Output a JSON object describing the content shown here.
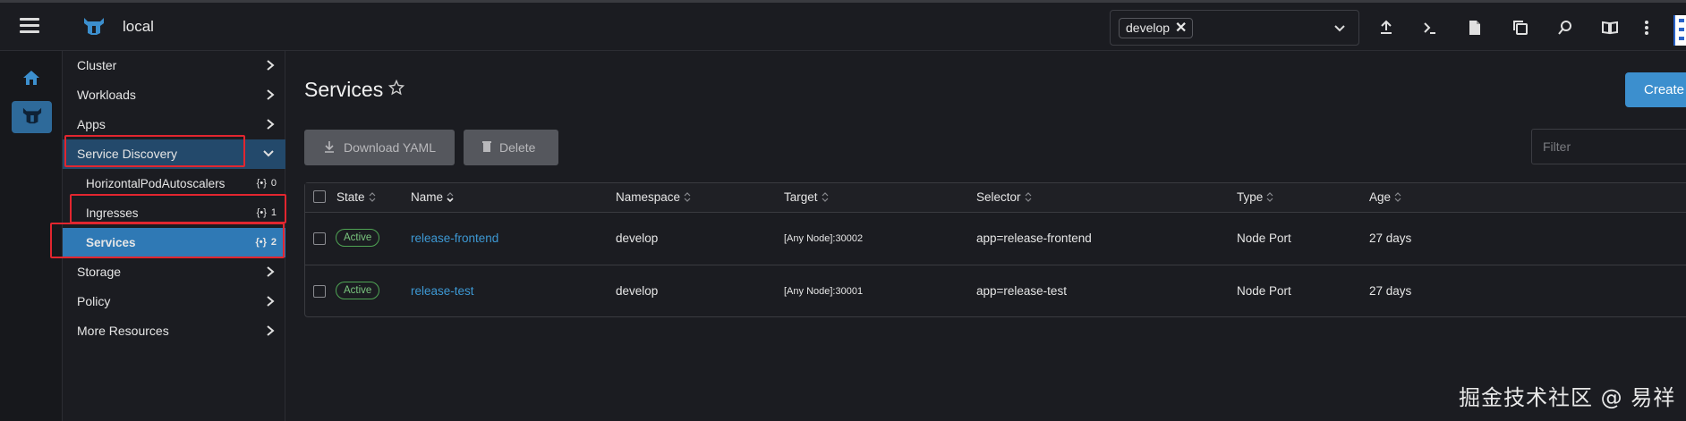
{
  "topbar": {
    "cluster_name": "local",
    "namespace_chip": "develop",
    "namespace_chip_remove": "✕",
    "icons": [
      "upload-icon",
      "terminal-icon",
      "file-icon",
      "copy-config-icon",
      "search-icon",
      "book-icon",
      "more-vertical-icon"
    ]
  },
  "rail": {
    "home_icon": "home-icon",
    "cluster_icon": "cluster-logo-icon"
  },
  "sidebar": {
    "items": [
      {
        "label": "Cluster"
      },
      {
        "label": "Workloads"
      },
      {
        "label": "Apps"
      },
      {
        "label": "Service Discovery"
      },
      {
        "label": "Storage"
      },
      {
        "label": "Policy"
      },
      {
        "label": "More Resources"
      }
    ],
    "sub_items": [
      {
        "label": "HorizontalPodAutoscalers",
        "count": "0"
      },
      {
        "label": "Ingresses",
        "count": "1"
      },
      {
        "label": "Services",
        "count": "2"
      }
    ]
  },
  "main": {
    "title": "Services",
    "create_label": "Create",
    "download_yaml_label": "Download YAML",
    "delete_label": "Delete",
    "filter_placeholder": "Filter",
    "columns": [
      "State",
      "Name",
      "Namespace",
      "Target",
      "Selector",
      "Type",
      "Age"
    ],
    "rows": [
      {
        "state": "Active",
        "name": "release-frontend",
        "namespace": "develop",
        "target": "[Any Node]:30002",
        "selector": "app=release-frontend",
        "type": "Node Port",
        "age": "27 days"
      },
      {
        "state": "Active",
        "name": "release-test",
        "namespace": "develop",
        "target": "[Any Node]:30001",
        "selector": "app=release-test",
        "type": "Node Port",
        "age": "27 days"
      }
    ]
  },
  "watermark": "掘金技术社区 @ 易祥",
  "colors": {
    "accent": "#3c8fce",
    "active_nav": "#2f79b5",
    "badge_green": "#4fa454",
    "highlight_red": "#e2262f"
  }
}
